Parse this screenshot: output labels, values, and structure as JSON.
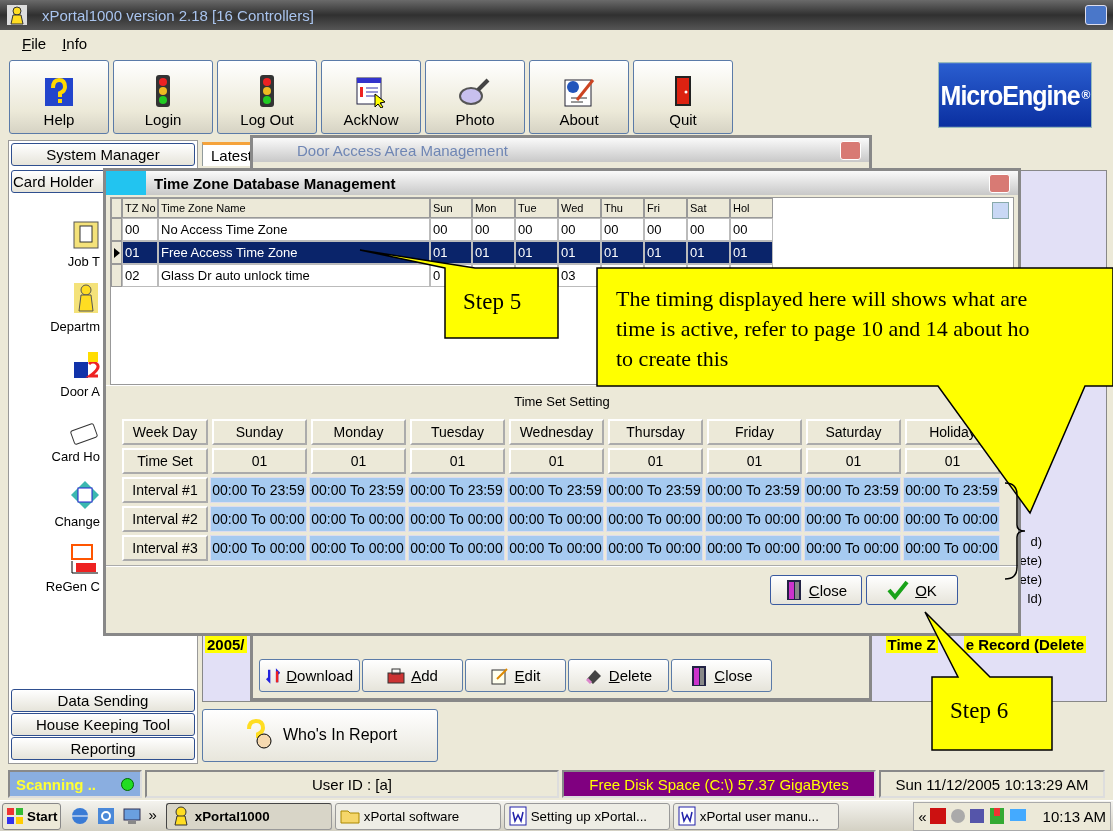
{
  "window": {
    "title": "xPortal1000 version 2.18 [16 Controllers]"
  },
  "menu": [
    {
      "label": "File"
    },
    {
      "label": "Info"
    }
  ],
  "toolbar": [
    {
      "label": "Help"
    },
    {
      "label": "Login"
    },
    {
      "label": "Log Out"
    },
    {
      "label": "AckNow"
    },
    {
      "label": "Photo"
    },
    {
      "label": "About"
    },
    {
      "label": "Quit"
    }
  ],
  "logo": {
    "text": "MicroEngine",
    "mark": "®"
  },
  "sidebar": {
    "header": "System Manager",
    "sub_button": "Card Holder",
    "items": [
      {
        "label": "Job T"
      },
      {
        "label": "Departm"
      },
      {
        "label": "Door A"
      },
      {
        "label": "Card Ho"
      },
      {
        "label": "Change"
      },
      {
        "label": "ReGen C"
      }
    ],
    "bottom": [
      "Data Sending",
      "House Keeping Tool",
      "Reporting"
    ]
  },
  "right_panel": {
    "tabs": [
      {
        "label": "Latest",
        "selected": true
      }
    ],
    "log_fragments": [
      "d)",
      "ete)",
      "ete)",
      "ld)"
    ],
    "highlight_left": "2005/",
    "highlight_right": [
      "Time Z",
      "e Record (Delete"
    ],
    "report_button": "Who's In Report"
  },
  "door_window": {
    "title": "Door Access Area Management",
    "buttons": [
      {
        "label": "Download"
      },
      {
        "label": "Add"
      },
      {
        "label": "Edit"
      },
      {
        "label": "Delete"
      },
      {
        "label": "Close"
      }
    ]
  },
  "tz_window": {
    "title": "Time Zone Database Management",
    "columns": [
      "TZ No",
      "Time Zone Name",
      "Sun",
      "Mon",
      "Tue",
      "Wed",
      "Thu",
      "Fri",
      "Sat",
      "Hol"
    ],
    "rows": [
      {
        "cells": [
          "00",
          "No Access Time Zone",
          "00",
          "00",
          "00",
          "00",
          "00",
          "00",
          "00",
          "00"
        ],
        "selected": false
      },
      {
        "cells": [
          "01",
          "Free Access Time Zone",
          "01",
          "01",
          "01",
          "01",
          "01",
          "01",
          "01",
          "01"
        ],
        "selected": true
      },
      {
        "cells": [
          "02",
          "Glass Dr auto unlock time",
          "0",
          null,
          null,
          "03",
          null,
          null,
          null,
          null
        ],
        "selected": false
      }
    ],
    "section_title": "Time Set Setting",
    "row_labels": [
      "Week Day",
      "Time Set",
      "Interval #1",
      "Interval #2",
      "Interval #3"
    ],
    "days": [
      {
        "day": "Sunday",
        "time_set": "01",
        "intervals": [
          "00:00 To 23:59",
          "00:00 To 00:00",
          "00:00 To 00:00"
        ]
      },
      {
        "day": "Monday",
        "time_set": "01",
        "intervals": [
          "00:00 To 23:59",
          "00:00 To 00:00",
          "00:00 To 00:00"
        ]
      },
      {
        "day": "Tuesday",
        "time_set": "01",
        "intervals": [
          "00:00 To 23:59",
          "00:00 To 00:00",
          "00:00 To 00:00"
        ]
      },
      {
        "day": "Wednesday",
        "time_set": "01",
        "intervals": [
          "00:00 To 23:59",
          "00:00 To 00:00",
          "00:00 To 00:00"
        ]
      },
      {
        "day": "Thursday",
        "time_set": "01",
        "intervals": [
          "00:00 To 23:59",
          "00:00 To 00:00",
          "00:00 To 00:00"
        ]
      },
      {
        "day": "Friday",
        "time_set": "01",
        "intervals": [
          "00:00 To 23:59",
          "00:00 To 00:00",
          "00:00 To 00:00"
        ]
      },
      {
        "day": "Saturday",
        "time_set": "01",
        "intervals": [
          "00:00 To 23:59",
          "00:00 To 00:00",
          "00:00 To 00:00"
        ]
      },
      {
        "day": "Holiday",
        "time_set": "01",
        "intervals": [
          "00:00 To 23:59",
          "00:00 To 00:00",
          "00:00 To 00:00"
        ]
      }
    ],
    "buttons": [
      {
        "label": "Close"
      },
      {
        "label": "OK"
      }
    ]
  },
  "callouts": [
    {
      "kind": "step5",
      "lines": [
        "Step 5"
      ]
    },
    {
      "kind": "note",
      "lines": [
        "The timing displayed here will shows what are",
        "time is active, refer to page 10 and 14 about ho",
        "to create this"
      ]
    },
    {
      "kind": "step6",
      "lines": [
        "Step 6"
      ]
    }
  ],
  "status_bar": {
    "scanning": "Scanning ..",
    "user": "User ID : [a]",
    "disk": "Free Disk Space (C:\\) 57.37   GigaBytes",
    "datetime": "Sun 11/12/2005 10:13:29 AM"
  },
  "taskbar": {
    "start": "Start",
    "chevron": "»",
    "tasks": [
      {
        "label": "xPortal1000",
        "selected": true
      },
      {
        "label": "xPortal software",
        "selected": false
      },
      {
        "label": "Setting up xPortal...",
        "selected": false
      },
      {
        "label": "xPortal user manu...",
        "selected": false
      }
    ],
    "tray_chevron": "«",
    "clock": "10:13 AM"
  }
}
